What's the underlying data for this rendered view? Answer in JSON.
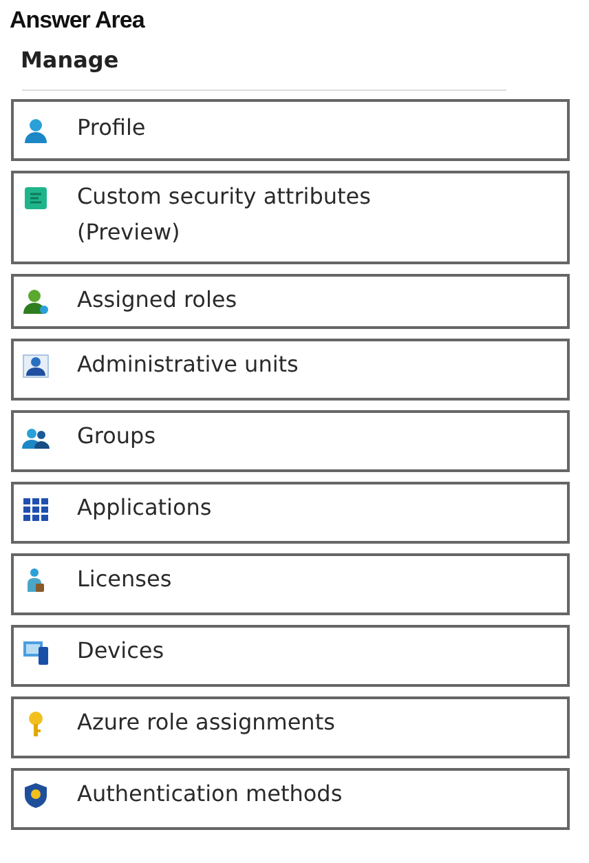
{
  "title": "Answer Area",
  "section": {
    "heading": "Manage"
  },
  "items": [
    {
      "label": "Profile"
    },
    {
      "label": "Custom security attributes (Preview)"
    },
    {
      "label": "Assigned roles"
    },
    {
      "label": "Administrative units"
    },
    {
      "label": "Groups"
    },
    {
      "label": "Applications"
    },
    {
      "label": "Licenses"
    },
    {
      "label": "Devices"
    },
    {
      "label": "Azure role assignments"
    },
    {
      "label": "Authentication methods"
    }
  ]
}
